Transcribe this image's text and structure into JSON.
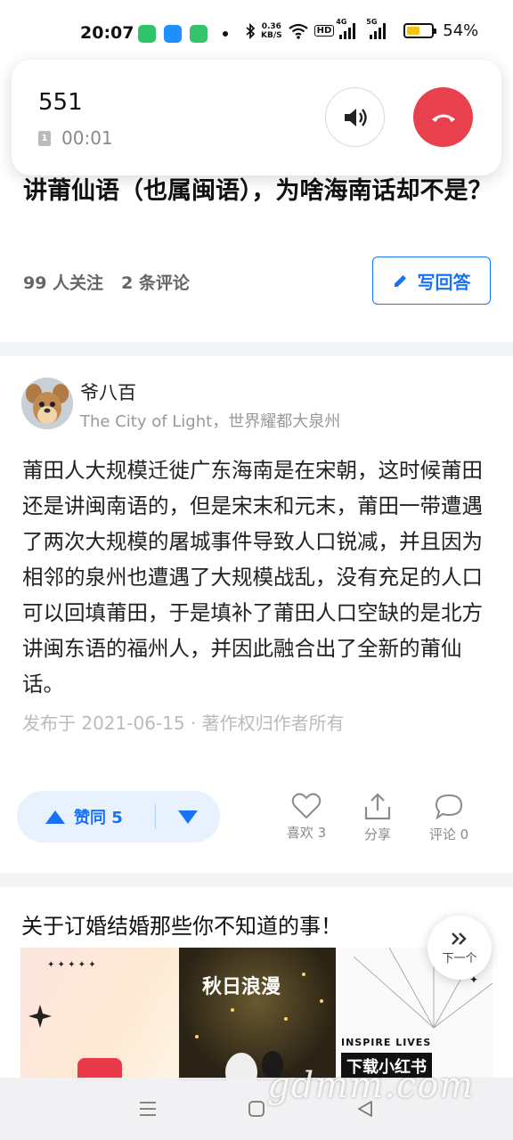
{
  "status_bar": {
    "time": "20:07",
    "net_speed_value": "0.36",
    "net_speed_unit": "KB/S",
    "hd_badge": "HD",
    "signal1_label": "4G",
    "signal2_label": "5G",
    "battery_percent": "54%",
    "battery_level": 0.54,
    "app_icon_colors": [
      "#2ec46a",
      "#1e90ff",
      "#35c46a"
    ]
  },
  "call": {
    "number": "551",
    "sim_slot": "1",
    "duration": "00:01",
    "speaker_icon": "speaker-icon",
    "hangup_icon": "hangup-icon",
    "hangup_color": "#e8404c"
  },
  "question": {
    "title": "讲莆仙语（也属闽语），为啥海南话却不是？",
    "followers": "99 人关注",
    "comments": "2 条评论",
    "write_answer_label": "写回答",
    "accent_color": "#1772f6"
  },
  "answer": {
    "author_name": "爷八百",
    "author_bio": "The City of Light，世界耀都大泉州",
    "body": "莆田人大规模迁徙广东海南是在宋朝，这时候莆田还是讲闽南语的，但是宋末和元末，莆田一带遭遇了两次大规模的屠城事件导致人口锐减，并且因为相邻的泉州也遭遇了大规模战乱，没有充足的人口可以回填莆田，于是填补了莆田人口空缺的是北方讲闽东语的福州人，并因此融合出了全新的莆仙话。",
    "published": "发布于 2021-06-15 · 著作权归作者所有",
    "upvote_label": "赞同 5",
    "like_label": "喜欢 3",
    "share_label": "分享",
    "comment_label": "评论 0"
  },
  "recommend": {
    "title": "关于订婚结婚那些你不知道的事！",
    "next_label": "下一个",
    "img2_text": "秋日浪漫",
    "img3_caption": "INSPIRE LIVES",
    "img3_brand": "下载小红书"
  },
  "watermark": "gdmm.com"
}
